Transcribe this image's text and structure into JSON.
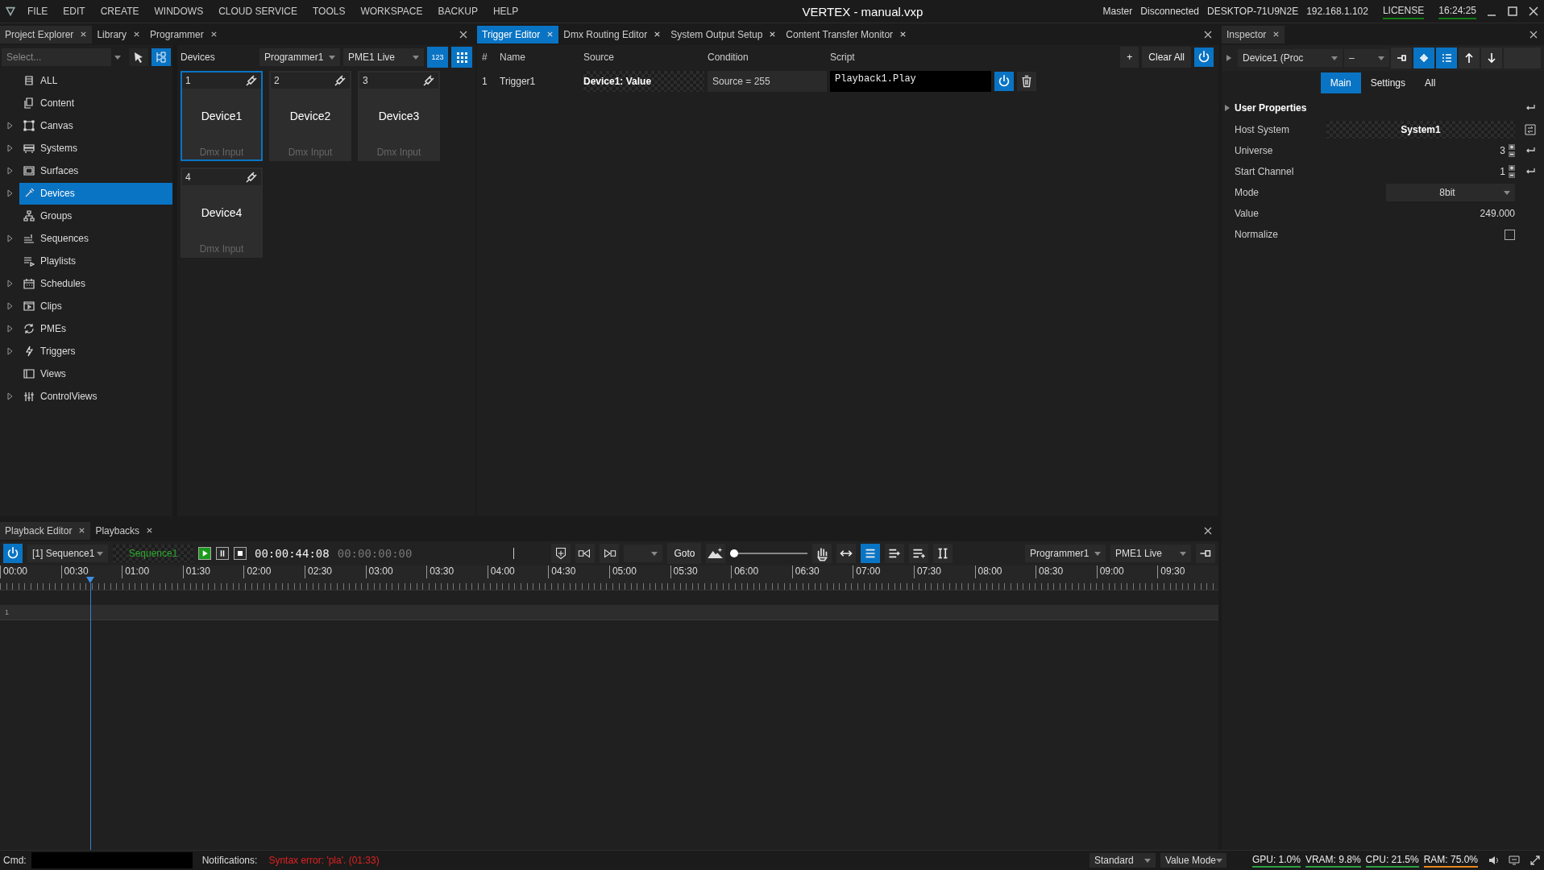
{
  "menu": {
    "items": [
      "FILE",
      "EDIT",
      "CREATE",
      "WINDOWS",
      "CLOUD SERVICE",
      "TOOLS",
      "WORKSPACE",
      "BACKUP",
      "HELP"
    ]
  },
  "title": "VERTEX - manual.vxp",
  "status": [
    {
      "text": "Master",
      "underlined": false
    },
    {
      "text": "Disconnected",
      "underlined": false
    },
    {
      "text": "DESKTOP-71U9N2E",
      "underlined": false
    },
    {
      "text": "192.168.1.102",
      "underlined": false
    },
    {
      "text": "LICENSE",
      "underlined": true
    },
    {
      "text": "16:24:25",
      "underlined": true
    }
  ],
  "explorer": {
    "tabs": [
      {
        "label": "Project Explorer",
        "selected": true
      },
      {
        "label": "Library",
        "selected": false
      },
      {
        "label": "Programmer",
        "selected": false
      }
    ],
    "select_placeholder": "Select...",
    "tree": [
      {
        "label": "ALL",
        "expandable": false,
        "selected": false
      },
      {
        "label": "Content",
        "expandable": false,
        "selected": false
      },
      {
        "label": "Canvas",
        "expandable": true,
        "selected": false
      },
      {
        "label": "Systems",
        "expandable": true,
        "selected": false
      },
      {
        "label": "Surfaces",
        "expandable": true,
        "selected": false
      },
      {
        "label": "Devices",
        "expandable": true,
        "selected": true
      },
      {
        "label": "Groups",
        "expandable": false,
        "selected": false
      },
      {
        "label": "Sequences",
        "expandable": true,
        "selected": false
      },
      {
        "label": "Playlists",
        "expandable": false,
        "selected": false
      },
      {
        "label": "Schedules",
        "expandable": true,
        "selected": false
      },
      {
        "label": "Clips",
        "expandable": true,
        "selected": false
      },
      {
        "label": "PMEs",
        "expandable": true,
        "selected": false
      },
      {
        "label": "Triggers",
        "expandable": true,
        "selected": false
      },
      {
        "label": "Views",
        "expandable": false,
        "selected": false
      },
      {
        "label": "ControlViews",
        "expandable": true,
        "selected": false
      }
    ]
  },
  "devices": {
    "title": "Devices",
    "programmer": "Programmer1",
    "pme": "PME1 Live",
    "number_view": {
      "label": "123",
      "selected": true
    },
    "grid_view": {
      "selected": true
    },
    "tiles": [
      {
        "number": "1",
        "name": "Device1",
        "type": "Dmx Input",
        "selected": true
      },
      {
        "number": "2",
        "name": "Device2",
        "type": "Dmx Input",
        "selected": false
      },
      {
        "number": "3",
        "name": "Device3",
        "type": "Dmx Input",
        "selected": false
      },
      {
        "number": "4",
        "name": "Device4",
        "type": "Dmx Input",
        "selected": false
      }
    ]
  },
  "trigger_editor": {
    "tabs": [
      {
        "label": "Trigger Editor",
        "selected": true
      },
      {
        "label": "Dmx Routing Editor",
        "selected": false
      },
      {
        "label": "System Output Setup",
        "selected": false
      },
      {
        "label": "Content Transfer Monitor",
        "selected": false
      }
    ],
    "columns": [
      "#",
      "Name",
      "Source",
      "Condition",
      "Script"
    ],
    "add_label": "+",
    "clear_label": "Clear All",
    "enabled": true,
    "rows": [
      {
        "number": "1",
        "name": "Trigger1",
        "source": "Device1: Value",
        "condition": "Source = 255",
        "script": "Playback1.Play",
        "enabled": true
      }
    ]
  },
  "inspector": {
    "tab": "Inspector",
    "object": "Device1 (Proc",
    "filter": "–",
    "buttons": [
      {
        "selected": false
      },
      {
        "selected": true
      },
      {
        "selected": true
      },
      {
        "selected": false
      },
      {
        "selected": false
      }
    ],
    "tabs": [
      {
        "label": "Main",
        "selected": true
      },
      {
        "label": "Settings",
        "selected": false
      },
      {
        "label": "All",
        "selected": false
      }
    ],
    "section": "User Properties",
    "properties": [
      {
        "kind": "link",
        "label": "Host System",
        "value": "System1"
      },
      {
        "kind": "number",
        "label": "Universe",
        "value": "3"
      },
      {
        "kind": "number",
        "label": "Start Channel",
        "value": "1"
      },
      {
        "kind": "dropdown",
        "label": "Mode",
        "value": "8bit"
      },
      {
        "kind": "readout",
        "label": "Value",
        "value": "249.000"
      },
      {
        "kind": "checkbox",
        "label": "Normalize",
        "checked": false
      }
    ]
  },
  "playback": {
    "tabs": [
      {
        "label": "Playback Editor",
        "selected": true
      },
      {
        "label": "Playbacks",
        "selected": false
      }
    ],
    "enabled": true,
    "sequence": "[1] Sequence1",
    "sequence_name": "Sequence1",
    "playing": true,
    "time": "00:00:44:08",
    "remaining": "00:00:00:00",
    "goto": "Goto",
    "zoom": {
      "level": 0.05
    },
    "view_buttons": [
      {
        "selected": false
      },
      {
        "selected": true
      },
      {
        "selected": false
      },
      {
        "selected": false
      },
      {
        "selected": false
      }
    ],
    "programmer": "Programmer1",
    "pme": "PME1 Live",
    "timeline": {
      "labels": [
        "00:00",
        "00:30",
        "01:00",
        "01:30",
        "02:00",
        "02:30",
        "03:00",
        "03:30",
        "04:00",
        "04:30",
        "05:00",
        "05:30",
        "06:00",
        "06:30",
        "07:00",
        "07:30",
        "08:00",
        "08:30",
        "09:00",
        "09:30"
      ],
      "playhead": {
        "level": 0.074
      }
    },
    "tracks": [
      "1"
    ]
  },
  "status_bar": {
    "cmd_label": "Cmd:",
    "notifications_label": "Notifications:",
    "error": "Syntax error: 'pla'. (01:33)",
    "modes": [
      "Standard",
      "Value Mode"
    ],
    "stats": [
      {
        "text": "GPU: 1.0%",
        "color": "#2ea043"
      },
      {
        "text": "VRAM: 9.8%",
        "color": "#2ea043"
      },
      {
        "text": "CPU: 21.5%",
        "color": "#2ea043"
      },
      {
        "text": "RAM: 75.0%",
        "color": "#e8871e"
      }
    ]
  }
}
